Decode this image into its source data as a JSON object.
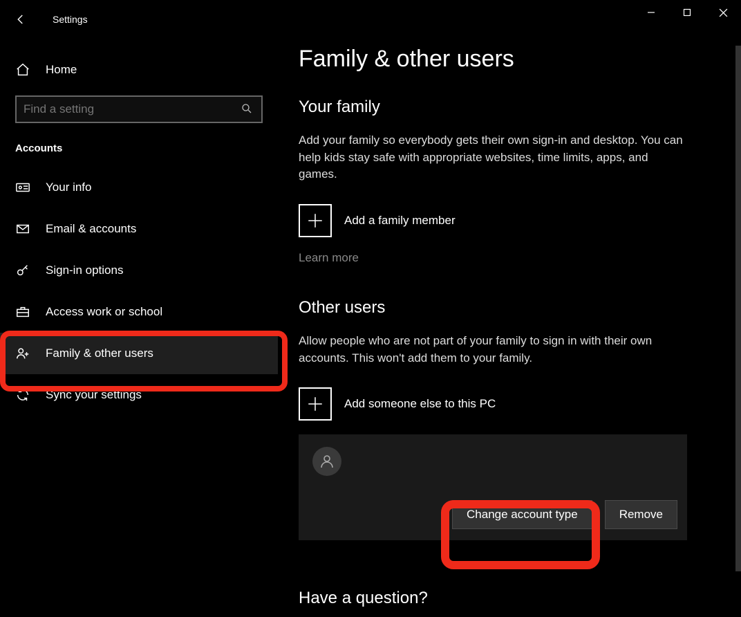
{
  "window": {
    "title": "Settings"
  },
  "sidebar": {
    "home": "Home",
    "search_placeholder": "Find a setting",
    "section": "Accounts",
    "items": [
      {
        "label": "Your info"
      },
      {
        "label": "Email & accounts"
      },
      {
        "label": "Sign-in options"
      },
      {
        "label": "Access work or school"
      },
      {
        "label": "Family & other users"
      },
      {
        "label": "Sync your settings"
      }
    ]
  },
  "main": {
    "title": "Family & other users",
    "family": {
      "heading": "Your family",
      "desc": "Add your family so everybody gets their own sign-in and desktop. You can help kids stay safe with appropriate websites, time limits, apps, and games.",
      "add_label": "Add a family member",
      "learn_more": "Learn more"
    },
    "other": {
      "heading": "Other users",
      "desc": "Allow people who are not part of your family to sign in with their own accounts. This won't add them to your family.",
      "add_label": "Add someone else to this PC",
      "change_btn": "Change account type",
      "remove_btn": "Remove"
    },
    "question": "Have a question?"
  },
  "annotation": {
    "highlight_color": "#ef2a1a"
  }
}
